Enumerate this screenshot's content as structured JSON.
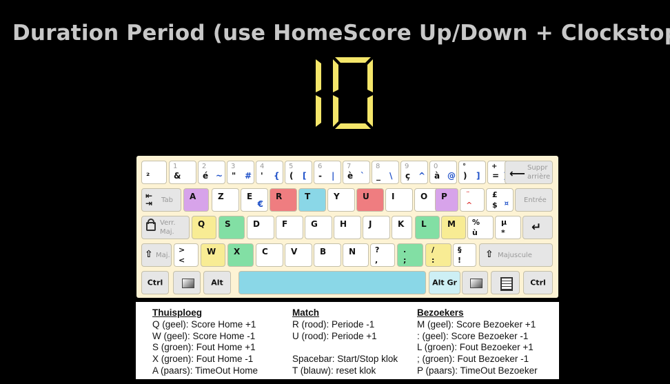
{
  "title": "Duration Period (use HomeScore Up/Down + Clockstop)",
  "display_value": "10",
  "colors": {
    "digit": "#f4e66a",
    "purple": "#d7a3ea",
    "red": "#ef7d80",
    "blue": "#8ad7e7",
    "green": "#82dfa4",
    "yellow": "#f8ec94"
  },
  "keyboard": {
    "row1": [
      {
        "tl": "",
        "bl": "²",
        "br": ""
      },
      {
        "tl": "1",
        "bl": "&",
        "br": ""
      },
      {
        "tl": "2",
        "bl": "é",
        "br": "~"
      },
      {
        "tl": "3",
        "bl": "\"",
        "br": "#"
      },
      {
        "tl": "4",
        "bl": "'",
        "br": "{"
      },
      {
        "tl": "5",
        "bl": "(",
        "br": "["
      },
      {
        "tl": "6",
        "bl": "-",
        "br": "|"
      },
      {
        "tl": "7",
        "bl": "è",
        "br": "`"
      },
      {
        "tl": "8",
        "bl": "_",
        "br": "\\"
      },
      {
        "tl": "9",
        "bl": "ç",
        "br": "^"
      },
      {
        "tl": "0",
        "bl": "à",
        "br": "@"
      },
      {
        "tl": "°",
        "bl": ")",
        "br": "]"
      },
      {
        "tl": "+",
        "bl": "=",
        "br": "}"
      }
    ],
    "backspace": {
      "line1": "Suppr",
      "line2": "arrière"
    },
    "tab": "Tab",
    "row2": [
      {
        "label": "A",
        "color": "purple"
      },
      {
        "label": "Z",
        "color": ""
      },
      {
        "label": "E",
        "color": "",
        "sub": "€"
      },
      {
        "label": "R",
        "color": "red"
      },
      {
        "label": "T",
        "color": "blue"
      },
      {
        "label": "Y",
        "color": ""
      },
      {
        "label": "U",
        "color": "red"
      },
      {
        "label": "I",
        "color": ""
      },
      {
        "label": "O",
        "color": ""
      },
      {
        "label": "P",
        "color": "purple"
      }
    ],
    "caret_key": {
      "top": "¨",
      "bottom": "^"
    },
    "pound_key": {
      "top": "£",
      "bottom": "$",
      "alt": "¤"
    },
    "enter": "Entrée",
    "capslock": {
      "line1": "Verr.",
      "line2": "Maj."
    },
    "row3": [
      {
        "label": "Q",
        "color": "yellow"
      },
      {
        "label": "S",
        "color": "green"
      },
      {
        "label": "D",
        "color": ""
      },
      {
        "label": "F",
        "color": ""
      },
      {
        "label": "G",
        "color": ""
      },
      {
        "label": "H",
        "color": ""
      },
      {
        "label": "J",
        "color": ""
      },
      {
        "label": "K",
        "color": ""
      },
      {
        "label": "L",
        "color": "green"
      },
      {
        "label": "M",
        "color": "yellow"
      }
    ],
    "percent_key": {
      "top": "%",
      "bottom": "ù"
    },
    "mu_key": {
      "top": "µ",
      "bottom": "*"
    },
    "shift_left": "Maj.",
    "angle_key": {
      "top": ">",
      "bottom": "<"
    },
    "row4": [
      {
        "label": "W",
        "color": "yellow"
      },
      {
        "label": "X",
        "color": "green"
      },
      {
        "label": "C",
        "color": ""
      },
      {
        "label": "V",
        "color": ""
      },
      {
        "label": "B",
        "color": ""
      },
      {
        "label": "N",
        "color": ""
      }
    ],
    "punct_keys": [
      {
        "top": "?",
        "bottom": ",",
        "color": ""
      },
      {
        "top": ".",
        "bottom": ";",
        "color": "green"
      },
      {
        "top": "/",
        "bottom": ":",
        "color": "yellow"
      },
      {
        "top": "§",
        "bottom": "!",
        "color": ""
      }
    ],
    "shift_right": "Majuscule",
    "ctrl_left": "Ctrl",
    "alt": "Alt",
    "altgr": "Alt Gr",
    "ctrl_right": "Ctrl"
  },
  "legend": {
    "thuisploeg": {
      "heading": "Thuisploeg",
      "lines": [
        "Q (geel): Score Home +1",
        "W (geel): Score Home -1",
        "S (groen): Fout Home +1",
        "X (groen): Fout Home -1",
        "A (paars): TimeOut Home"
      ]
    },
    "match": {
      "heading": "Match",
      "lines": [
        "R (rood): Periode -1",
        "U (rood): Periode +1",
        "",
        "Spacebar: Start/Stop klok",
        "T (blauw): reset klok"
      ]
    },
    "bezoekers": {
      "heading": "Bezoekers",
      "lines": [
        "M (geel): Score Bezoeker +1",
        " : (geel): Score Bezoeker -1",
        "L (groen): Fout Bezoeker +1",
        " ; (groen): Fout Bezoeker -1",
        "P (paars): TimeOut Bezoeker"
      ]
    }
  }
}
